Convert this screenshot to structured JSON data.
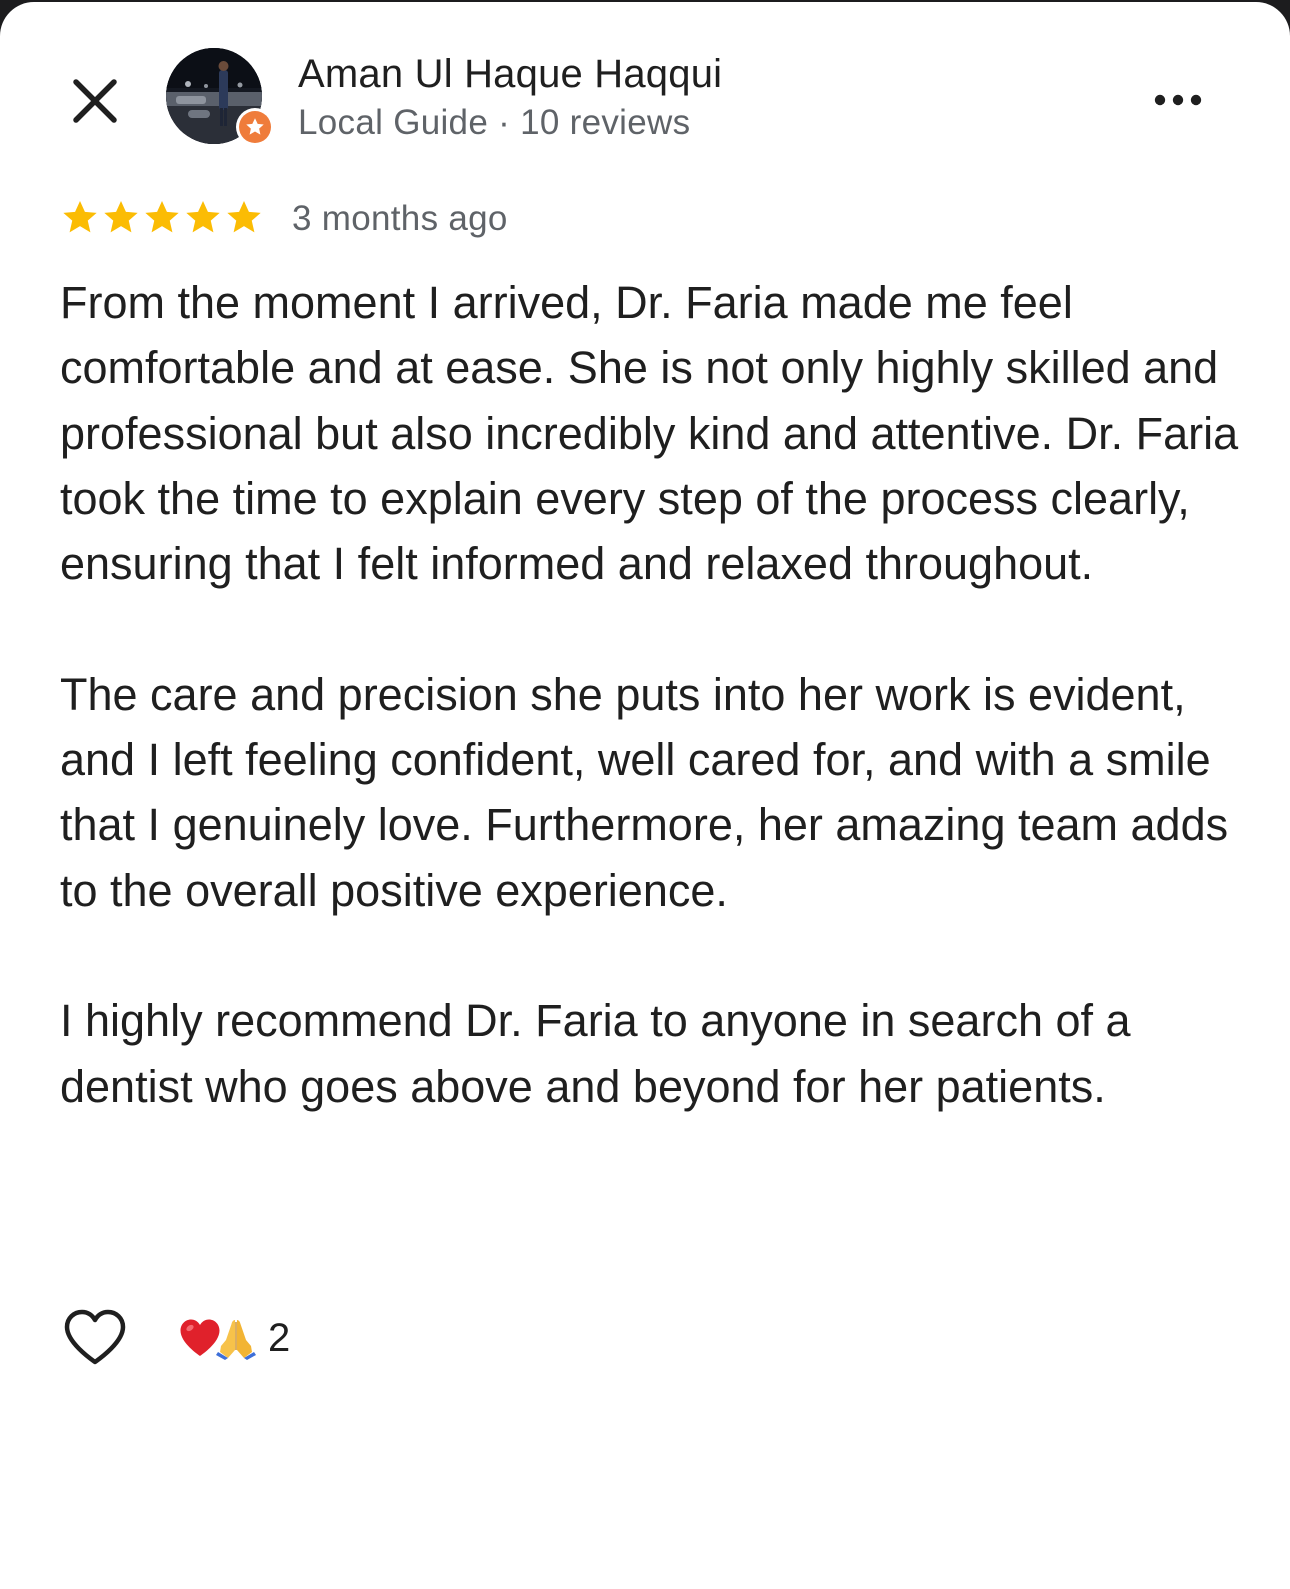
{
  "header": {
    "close_icon": "close-icon",
    "author_name": "Aman Ul Haque Haqqui",
    "author_meta": "Local Guide · 10 reviews",
    "badge_icon": "local-guide-star-icon",
    "badge_color": "#ef7c3b",
    "more_icon": "more-horizontal-icon"
  },
  "rating": {
    "stars": 5,
    "max_stars": 5,
    "star_color": "#fbbc04",
    "time_ago": "3 months ago"
  },
  "review": {
    "paragraphs": [
      "From the moment I arrived, Dr. Faria made me feel comfortable and at ease. She is not only highly skilled and professional but also incredibly kind and attentive. Dr. Faria took the time to explain every step of the process clearly, ensuring that I felt informed and relaxed throughout.",
      "The care and precision she puts into her work is evident, and I left feeling confident, well cared for, and with a smile that I genuinely love. Furthermore, her amazing team adds to the overall positive experience.",
      "I highly recommend Dr. Faria to anyone in search of a dentist who goes above and beyond for her patients."
    ]
  },
  "footer": {
    "like_icon": "heart-outline-icon",
    "reaction_icons": [
      "red-heart-icon",
      "folded-hands-icon"
    ],
    "reaction_count": "2"
  }
}
